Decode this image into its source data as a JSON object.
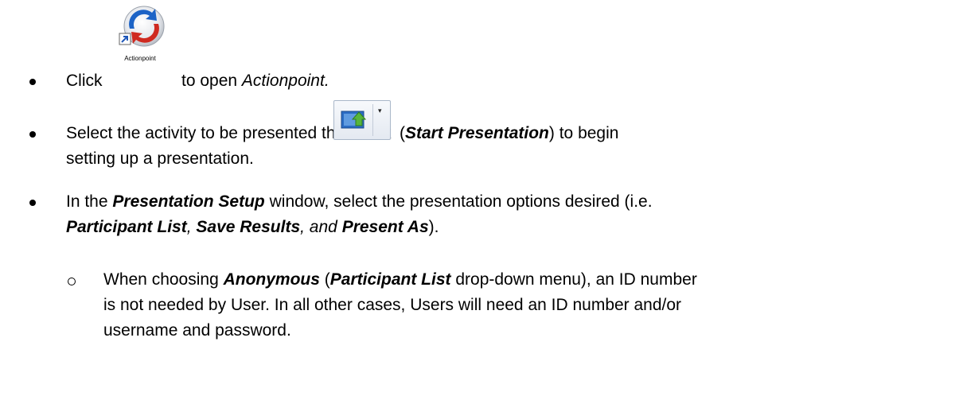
{
  "icons": {
    "actionpoint": {
      "name": "actionpoint-app-icon",
      "label": "Actionpoint",
      "colors": {
        "blue": "#1c63c6",
        "red": "#cf2a20",
        "silver": "#d6d9de"
      }
    },
    "start_presentation": {
      "name": "start-presentation-icon",
      "colors": {
        "screen": "#2b6cc4",
        "arrow": "#57b53b"
      }
    }
  },
  "steps": [
    {
      "click": "Click",
      "after_icon": "to open",
      "app": "Actionpoint."
    },
    {
      "before_icon": "Select the activity to be presented then click",
      "paren_open": "(",
      "button_name": "Start Presentation",
      "paren_close_tail": ") to begin",
      "line2": "setting up a presentation."
    },
    {
      "lead": "In the",
      "window_name": "Presentation Setup",
      "tail": "window, select the presentation options desired (i.e.",
      "opt1": "Participant List",
      "sep1": ",",
      "opt2": "Save Results",
      "sep2": ", and",
      "opt3": "Present As",
      "end": ")."
    }
  ],
  "sub_steps": [
    {
      "lead": "When choosing",
      "mode": "Anonymous",
      "paren_open": "(",
      "menu": "Participant List",
      "menu_tail": "drop-down menu), an ID number",
      "line2": "is not needed by User. In all other cases, Users will need an ID number and/or",
      "line3": "username and password."
    }
  ]
}
